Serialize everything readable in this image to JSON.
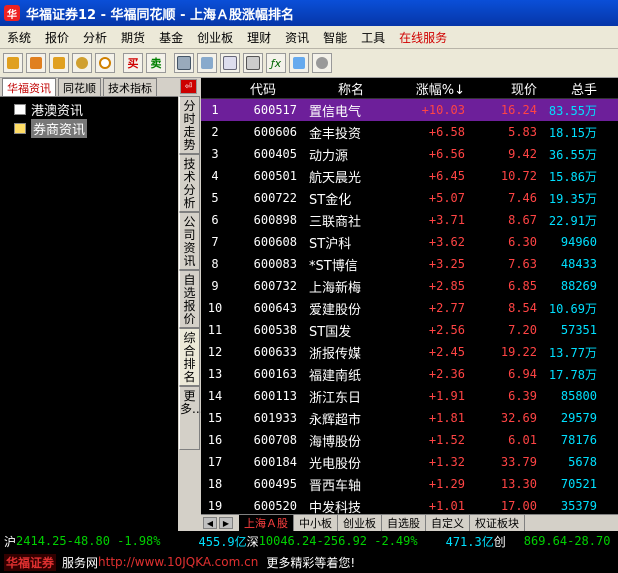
{
  "window": {
    "title": "华福证券12 - 华福同花顺 - 上海Ａ股涨幅排名",
    "logo_text": "华"
  },
  "menu": [
    "系统",
    "报价",
    "分析",
    "期货",
    "基金",
    "创业板",
    "理财",
    "资讯",
    "智能",
    "工具",
    "在线服务"
  ],
  "toolbar": {
    "buy_label": "买",
    "sell_label": "卖"
  },
  "left_panel": {
    "tabs": [
      "华福资讯",
      "同花顺",
      "技术指标"
    ],
    "tree": [
      "港澳资讯",
      "券商资讯"
    ]
  },
  "side_tabs": [
    "分时走势",
    "技术分析",
    "公司资讯",
    "自选报价",
    "综合排名",
    "更多..."
  ],
  "table": {
    "headers": {
      "code": "代码",
      "name": "称名",
      "change": "涨幅%",
      "price": "现价",
      "volume": "总手"
    },
    "rows": [
      {
        "no": "1",
        "code": "600517",
        "name": "置信电气",
        "change": "+10.03",
        "price": "16.24",
        "volume": "83.55万"
      },
      {
        "no": "2",
        "code": "600606",
        "name": "金丰投资",
        "change": "+6.58",
        "price": "5.83",
        "volume": "18.15万"
      },
      {
        "no": "3",
        "code": "600405",
        "name": "动力源",
        "change": "+6.56",
        "price": "9.42",
        "volume": "36.55万"
      },
      {
        "no": "4",
        "code": "600501",
        "name": "航天晨光",
        "change": "+6.45",
        "price": "10.72",
        "volume": "15.86万"
      },
      {
        "no": "5",
        "code": "600722",
        "name": "ST金化",
        "change": "+5.07",
        "price": "7.46",
        "volume": "19.35万"
      },
      {
        "no": "6",
        "code": "600898",
        "name": "三联商社",
        "change": "+3.71",
        "price": "8.67",
        "volume": "22.91万"
      },
      {
        "no": "7",
        "code": "600608",
        "name": "ST沪科",
        "change": "+3.62",
        "price": "6.30",
        "volume": "94960"
      },
      {
        "no": "8",
        "code": "600083",
        "name": "*ST博信",
        "change": "+3.25",
        "price": "7.63",
        "volume": "48433"
      },
      {
        "no": "9",
        "code": "600732",
        "name": "上海新梅",
        "change": "+2.85",
        "price": "6.85",
        "volume": "88269"
      },
      {
        "no": "10",
        "code": "600643",
        "name": "爱建股份",
        "change": "+2.77",
        "price": "8.54",
        "volume": "10.69万"
      },
      {
        "no": "11",
        "code": "600538",
        "name": "ST国发",
        "change": "+2.56",
        "price": "7.20",
        "volume": "57351"
      },
      {
        "no": "12",
        "code": "600633",
        "name": "浙报传媒",
        "change": "+2.45",
        "price": "19.22",
        "volume": "13.77万"
      },
      {
        "no": "13",
        "code": "600163",
        "name": "福建南纸",
        "change": "+2.36",
        "price": "6.94",
        "volume": "17.78万"
      },
      {
        "no": "14",
        "code": "600113",
        "name": "浙江东日",
        "change": "+1.91",
        "price": "6.39",
        "volume": "85800"
      },
      {
        "no": "15",
        "code": "601933",
        "name": "永辉超市",
        "change": "+1.81",
        "price": "32.69",
        "volume": "29579"
      },
      {
        "no": "16",
        "code": "600708",
        "name": "海博股份",
        "change": "+1.52",
        "price": "6.01",
        "volume": "78176"
      },
      {
        "no": "17",
        "code": "600184",
        "name": "光电股份",
        "change": "+1.32",
        "price": "33.79",
        "volume": "5678"
      },
      {
        "no": "18",
        "code": "600495",
        "name": "晋西车轴",
        "change": "+1.29",
        "price": "13.30",
        "volume": "70521"
      },
      {
        "no": "19",
        "code": "600520",
        "name": "中发科技",
        "change": "+1.01",
        "price": "17.00",
        "volume": "35379"
      }
    ]
  },
  "bottom_tabs": [
    "上海Ａ股",
    "中小板",
    "创业板",
    "自选股",
    "自定义",
    "权证板块"
  ],
  "status": {
    "sh_prefix": "沪",
    "sh_value": "2414.25-48.80 -1.98%",
    "sh_amount": "455.9亿",
    "sz_prefix": "深",
    "sz_value": "10046.24-256.92 -2.49%",
    "sz_amount": "471.3亿",
    "cy_prefix": "创",
    "cy_value": "869.64-28.70",
    "brand": "华福证券",
    "service": "服务网",
    "url": "http://www.10JQKA.com.cn",
    "more": "更多精彩等着您!"
  },
  "colors": {
    "up": "#ff4444",
    "volume": "#00e0ff",
    "selected_row": "#6d1f9a",
    "title_bar": "#0a4fd8"
  }
}
